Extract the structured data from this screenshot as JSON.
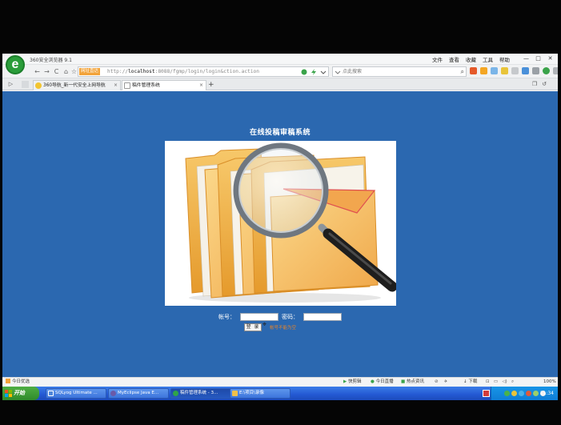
{
  "browser": {
    "title": "360安全浏览器 9.1",
    "logo_letter": "e",
    "menu": [
      "文件",
      "查看",
      "收藏",
      "工具",
      "帮助"
    ],
    "window_controls": [
      "—",
      "□",
      "✕"
    ]
  },
  "toolbar": {
    "back": "←",
    "forward": "→",
    "refresh": "C",
    "home": "⌂",
    "favorite": "☆",
    "url_badge": "网址直达",
    "url_prefix": "http://",
    "url_host": "localhost",
    "url_rest": ":8088/fgmp/login/login&ction.action",
    "search_placeholder": "点此搜索",
    "search_icon": "⌕"
  },
  "tabs": [
    {
      "label": "360导航_新一代安全上网导航",
      "active": false,
      "close": "×"
    },
    {
      "label": "稿件管理系统",
      "active": true,
      "close": "×"
    }
  ],
  "new_tab": "+",
  "page": {
    "title": "在线投稿审稿系统",
    "account_label": "帐号：",
    "account_value": "",
    "password_label": "密码：",
    "password_value": "",
    "login_button": "登 录",
    "warning": "帐号不能为空"
  },
  "statusbar": {
    "left": "今日优选",
    "items": [
      "快剪辑",
      "今日直播",
      "热点资讯"
    ],
    "download": "下载",
    "zoom": "100%"
  },
  "taskbar": {
    "start": "开始",
    "tasks": [
      {
        "label": "SQLyog Ultimate ...",
        "color": "#4f86d8",
        "active": false
      },
      {
        "label": "MyEclipse Java E...",
        "color": "#6a5aa8",
        "active": false
      },
      {
        "label": "稿件管理系统 - 3...",
        "color": "#2fa44a",
        "active": true
      },
      {
        "label": "E:\\项目\\录像",
        "color": "#f1c04a",
        "active": false
      }
    ],
    "clock": "11:34"
  },
  "colors": {
    "page_bg": "#2b68b0",
    "warning": "#e4832c",
    "taskbar": "#2358d2"
  }
}
